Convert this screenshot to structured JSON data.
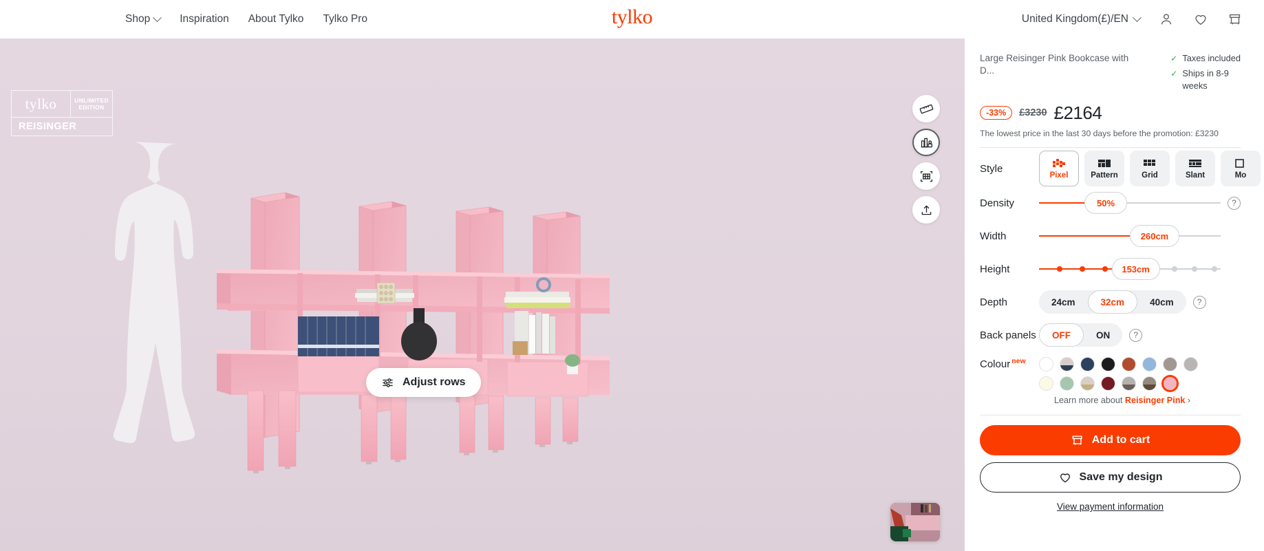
{
  "nav": {
    "links": [
      {
        "label": "Shop",
        "has_chevron": true
      },
      {
        "label": "Inspiration",
        "has_chevron": false
      },
      {
        "label": "About Tylko",
        "has_chevron": false
      },
      {
        "label": "Tylko Pro",
        "has_chevron": false
      }
    ],
    "brand": "tylko",
    "country": "United Kingdom(£)/EN",
    "icons": [
      "account-icon",
      "wishlist-heart-icon",
      "cart-icon"
    ]
  },
  "viewer": {
    "watermark": {
      "logo": "tylko",
      "edition_line1": "UNLIMITED",
      "edition_line2": "EDITION",
      "collection": "REISINGER"
    },
    "adjust_rows_label": "Adjust rows",
    "tools": [
      "ruler-icon",
      "room-view-icon",
      "dimensions-icon",
      "share-upload-icon"
    ],
    "thumbnail_name": "assembly-video-thumbnail"
  },
  "product": {
    "title": "Large Reisinger Pink Bookcase with D...",
    "shipping": [
      "Taxes included",
      "Ships in 8-9 weeks"
    ],
    "discount_badge": "-33%",
    "old_price": "£3230",
    "price": "£2164",
    "lowest_price_note": "The lowest price in the last 30 days before the promotion: £3230"
  },
  "config": {
    "style": {
      "label": "Style",
      "options": [
        {
          "label": "Pixel",
          "icon": "pixel-icon",
          "selected": true
        },
        {
          "label": "Pattern",
          "icon": "pattern-icon",
          "selected": false
        },
        {
          "label": "Grid",
          "icon": "grid-icon",
          "selected": false
        },
        {
          "label": "Slant",
          "icon": "slant-icon",
          "selected": false
        },
        {
          "label": "Mo",
          "icon": "more-icon",
          "selected": false
        }
      ]
    },
    "density": {
      "label": "Density",
      "value": "50%",
      "fill_pct": 30,
      "has_help": true
    },
    "width": {
      "label": "Width",
      "value": "260cm",
      "fill_pct": 58,
      "has_help": false
    },
    "height": {
      "label": "Height",
      "value": "153cm",
      "fill_pct": 42,
      "has_help": false,
      "stops_filled": 3,
      "stops_empty": 4
    },
    "depth": {
      "label": "Depth",
      "options": [
        "24cm",
        "32cm",
        "40cm"
      ],
      "selected": "32cm",
      "has_help": true
    },
    "back_panels": {
      "label": "Back panels",
      "options": [
        "OFF",
        "ON"
      ],
      "selected": "OFF",
      "has_help": true
    },
    "colour": {
      "label": "Colour",
      "badge": "new",
      "row1": [
        {
          "name": "white",
          "top": "#ffffff",
          "bottom": null,
          "selected": false
        },
        {
          "name": "beige-navy",
          "top": "#d8cec9",
          "bottom": "#2d3f58",
          "selected": false
        },
        {
          "name": "navy",
          "top": "#2b415e",
          "bottom": null,
          "selected": false
        },
        {
          "name": "black",
          "top": "#1c1c1e",
          "bottom": null,
          "selected": false
        },
        {
          "name": "rust",
          "top": "#b24c2e",
          "bottom": null,
          "selected": false
        },
        {
          "name": "light-blue",
          "top": "#92b6dc",
          "bottom": null,
          "selected": false
        },
        {
          "name": "warm-grey",
          "top": "#a39791",
          "bottom": null,
          "selected": false
        },
        {
          "name": "grey",
          "top": "#b8b5b2",
          "bottom": null,
          "selected": false
        }
      ],
      "row2": [
        {
          "name": "cream",
          "top": "#fbfae4",
          "bottom": null,
          "selected": false
        },
        {
          "name": "sage-green",
          "top": "#a6c6af",
          "bottom": null,
          "selected": false
        },
        {
          "name": "beige-sand",
          "top": "#d9cfc7",
          "bottom": "#c0b183",
          "selected": false
        },
        {
          "name": "burgundy",
          "top": "#761a22",
          "bottom": null,
          "selected": false
        },
        {
          "name": "grey-dark-grey",
          "top": "#b5b1ae",
          "bottom": "#6a6059",
          "selected": false
        },
        {
          "name": "taupe-brown",
          "top": "#968a7e",
          "bottom": "#5e4a3a",
          "selected": false
        },
        {
          "name": "reisinger-pink",
          "top": "#f2b5c4",
          "bottom": null,
          "selected": true
        }
      ],
      "learn_more_prefix": "Learn more about ",
      "learn_more_name": "Reisinger Pink",
      "learn_more_arrow": "›"
    }
  },
  "actions": {
    "add_to_cart": "Add to cart",
    "save_design": "Save my design",
    "payment_info": "View payment information"
  },
  "colors": {
    "accent": "#fa3c00",
    "viewer_bg": "#e2d5de",
    "furniture": "#f4aebb"
  }
}
